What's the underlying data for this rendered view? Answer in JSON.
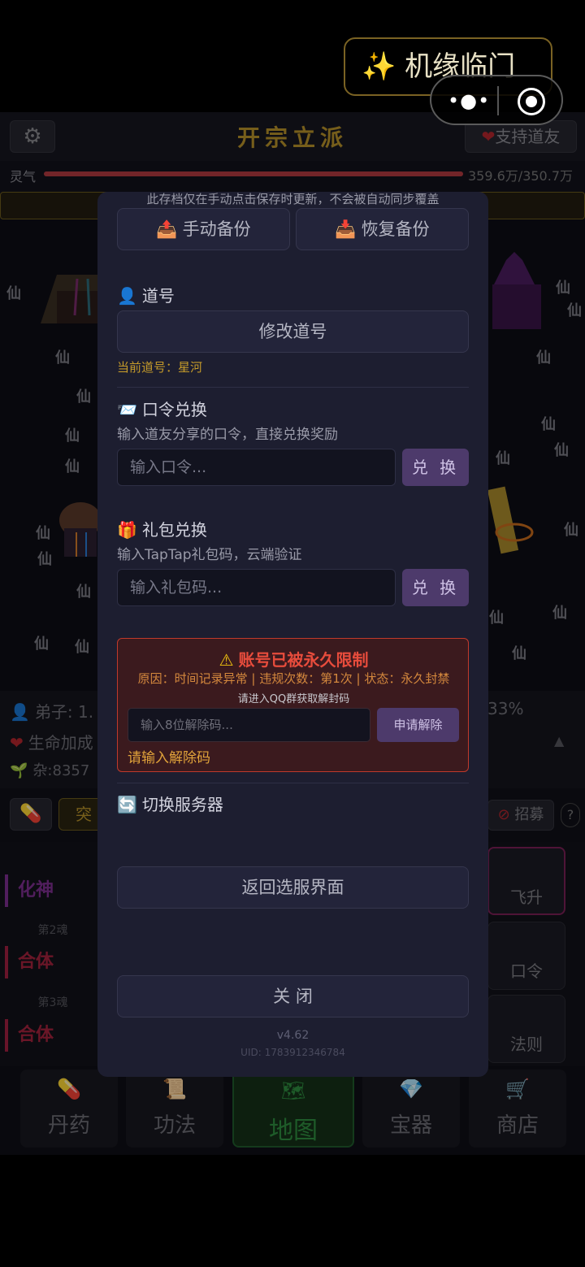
{
  "banner": {
    "spark_icon": "sparkles-icon",
    "text": "机缘临门"
  },
  "capsule": {
    "menu_icon": "more-dots-icon",
    "close_icon": "target-close-icon"
  },
  "header": {
    "title": "开宗立派",
    "support_label": "支持道友",
    "settings_icon": "gear-icon"
  },
  "qi": {
    "label": "灵气",
    "value": "359.6万/350.7万",
    "fill_fraction": 1.0
  },
  "scene": {
    "glyph": "仙"
  },
  "stats": {
    "disciples": "弟子: 1.",
    "percent": "33%",
    "life_bonus": "生命加成",
    "misc": "杂:8357"
  },
  "actions": {
    "breakthrough": "突",
    "recruit": "招募",
    "help": "?"
  },
  "realms": {
    "items": [
      "化神",
      "合体",
      "合体"
    ],
    "souls": [
      "第2魂",
      "第3魂"
    ]
  },
  "side_tiles": [
    "飞升",
    "口令",
    "法则"
  ],
  "bottom_nav": [
    {
      "label": "丹药",
      "icon": "pill-icon"
    },
    {
      "label": "功法",
      "icon": "scroll-icon"
    },
    {
      "label": "地图",
      "icon": "map-icon"
    },
    {
      "label": "宝器",
      "icon": "gem-icon"
    },
    {
      "label": "商店",
      "icon": "cart-icon"
    }
  ],
  "modal": {
    "backup_note": "此存档仅在手动点击保存时更新，不会被自动同步覆盖",
    "manual_backup": "手动备份",
    "restore_backup": "恢复备份",
    "dao_title": "道号",
    "rename_button": "修改道号",
    "current_dao": "当前道号：星河",
    "code_title": "口令兑换",
    "code_desc": "输入道友分享的口令，直接兑换奖励",
    "code_placeholder": "输入口令...",
    "redeem_label": "兑 换",
    "gift_title": "礼包兑换",
    "gift_desc": "输入TapTap礼包码，云端验证",
    "gift_placeholder": "输入礼包码...",
    "ban_title": "账号已被永久限制",
    "ban_reason": "原因：时间记录异常 | 违规次数：第1次 | 状态：永久封禁",
    "ban_tip": "请进入QQ群获取解封码",
    "unlock_placeholder": "输入8位解除码...",
    "apply_unlock": "申请解除",
    "unlock_status": "请输入解除码",
    "server_title": "切换服务器",
    "return_server": "返回选服界面",
    "close": "关 闭",
    "version": "v4.62",
    "uid": "UID: 1783912346784"
  }
}
